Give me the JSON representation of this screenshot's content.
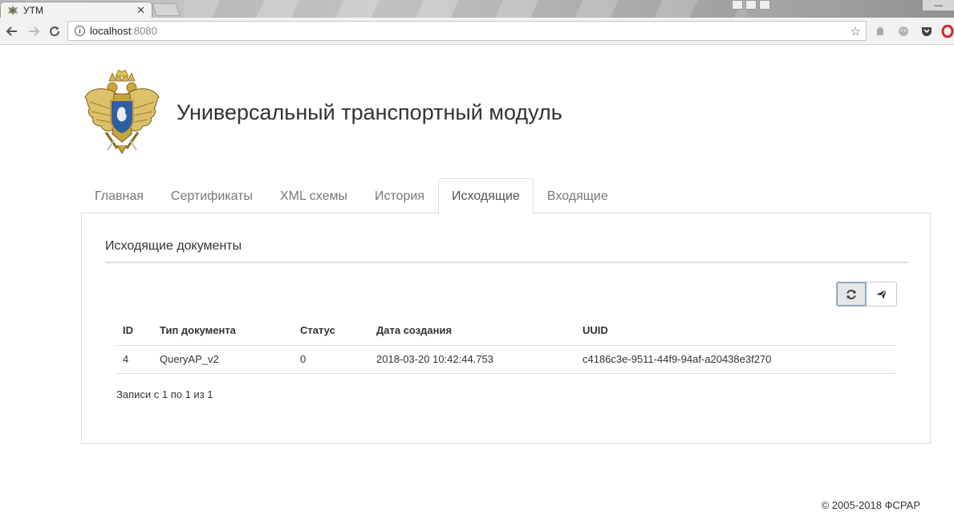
{
  "browser": {
    "tab_title": "УТМ",
    "tab_close": "✕",
    "url_host": "localhost",
    "url_port": ":8080"
  },
  "header": {
    "title": "Универсальный транспортный модуль"
  },
  "nav": {
    "tabs": [
      {
        "label": "Главная",
        "active": false
      },
      {
        "label": "Сертификаты",
        "active": false
      },
      {
        "label": "XML схемы",
        "active": false
      },
      {
        "label": "История",
        "active": false
      },
      {
        "label": "Исходящие",
        "active": true
      },
      {
        "label": "Входящие",
        "active": false
      }
    ]
  },
  "panel": {
    "heading": "Исходящие документы",
    "refresh_icon": "refresh-icon",
    "send_icon": "send-icon"
  },
  "table": {
    "columns": [
      "ID",
      "Тип документа",
      "Статус",
      "Дата создания",
      "UUID"
    ],
    "rows": [
      [
        "4",
        "QueryAP_v2",
        "0",
        "2018-03-20 10:42:44.753",
        "c4186c3e-9511-44f9-94af-a20438e3f270"
      ]
    ],
    "info": "Записи с 1 по 1 из 1"
  },
  "footer": {
    "copyright": "© 2005-2018 ФСРАР"
  },
  "colors": {
    "border": "#dddddd",
    "active_button_outline": "#7aa7d6"
  }
}
